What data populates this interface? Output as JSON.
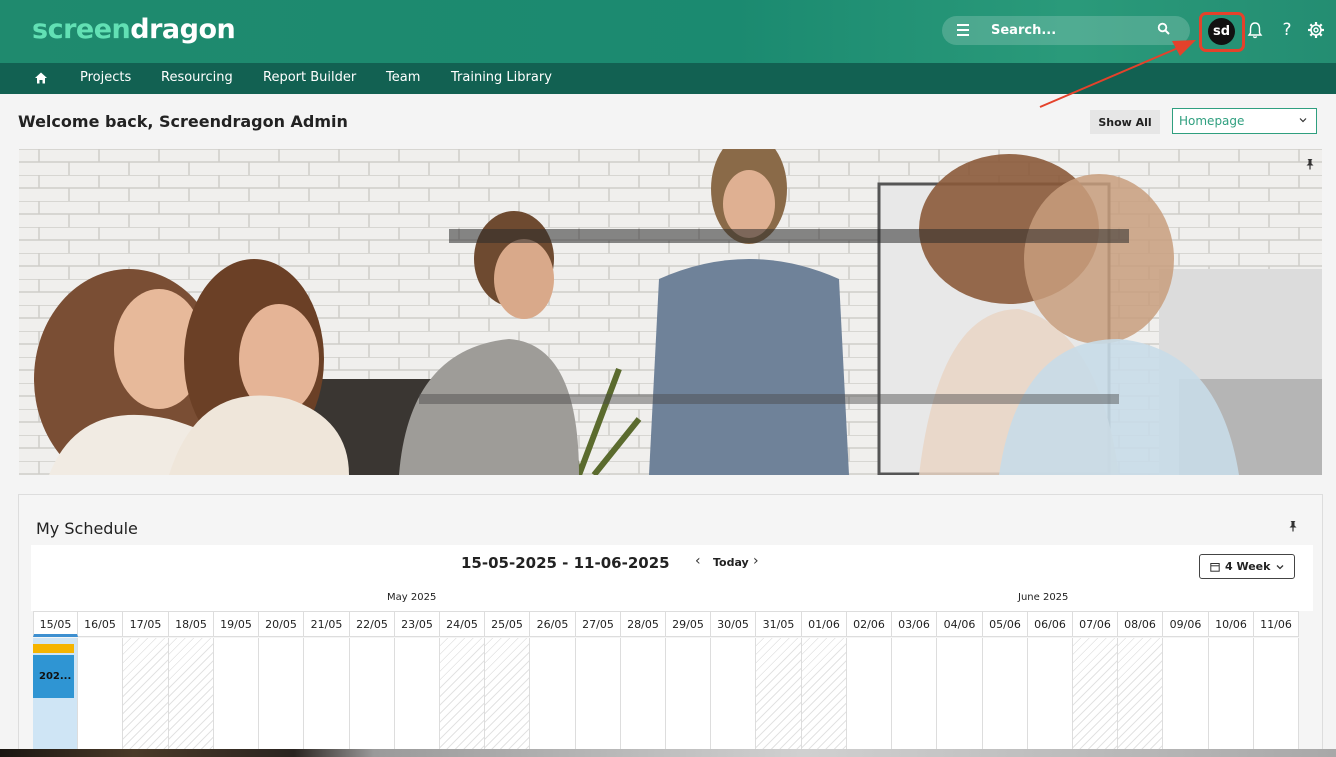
{
  "header": {
    "logo_part1": "screen",
    "logo_part2": "dragon",
    "search_placeholder": "Search...",
    "avatar_initials": "sd",
    "help_label": "?"
  },
  "nav": {
    "items": [
      {
        "label": "Projects"
      },
      {
        "label": "Resourcing"
      },
      {
        "label": "Report Builder"
      },
      {
        "label": "Team"
      },
      {
        "label": "Training Library"
      }
    ]
  },
  "page": {
    "welcome": "Welcome back, Screendragon Admin",
    "show_all": "Show All",
    "homepage_select": "Homepage"
  },
  "schedule": {
    "title": "My Schedule",
    "range": "15-05-2025 - 11-06-2025",
    "prev": "‹",
    "today": "Today",
    "next": "›",
    "view": "4 Week",
    "months": [
      "May 2025",
      "June 2025"
    ],
    "days": [
      "15/05",
      "16/05",
      "17/05",
      "18/05",
      "19/05",
      "20/05",
      "21/05",
      "22/05",
      "23/05",
      "24/05",
      "25/05",
      "26/05",
      "27/05",
      "28/05",
      "29/05",
      "30/05",
      "31/05",
      "01/06",
      "02/06",
      "03/06",
      "04/06",
      "05/06",
      "06/06",
      "07/06",
      "08/06",
      "09/06",
      "10/06",
      "11/06"
    ],
    "event_label": "202..."
  },
  "colors": {
    "header_green": "#1f8a6e",
    "nav_green": "#126152",
    "accent": "#2f9f7f",
    "highlight_red": "#e4422b",
    "event_yellow": "#f5b400",
    "event_blue": "#2f95d3"
  },
  "icons": {
    "menu": "menu-icon",
    "search": "search-icon",
    "bell": "bell-icon",
    "help": "help-icon",
    "settings": "gear-icon",
    "home": "home-icon",
    "pin": "pin-icon",
    "calendar": "calendar-icon"
  }
}
